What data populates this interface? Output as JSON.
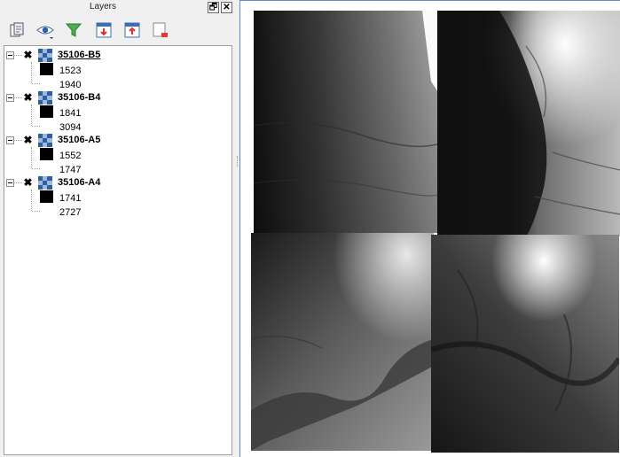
{
  "panel": {
    "title": "Layers",
    "float_symbol": "🗗",
    "close_symbol": "✕"
  },
  "toolbar": {
    "buttons": [
      "add-layer-icon",
      "visibility-icon",
      "filter-icon",
      "expand-all-icon",
      "collapse-all-icon",
      "remove-layer-icon"
    ]
  },
  "layers": [
    {
      "name": "35106-B5",
      "checked": true,
      "min": "1523",
      "max": "1940"
    },
    {
      "name": "35106-B4",
      "checked": true,
      "min": "1841",
      "max": "3094"
    },
    {
      "name": "35106-A5",
      "checked": true,
      "min": "1552",
      "max": "1747"
    },
    {
      "name": "35106-A4",
      "checked": true,
      "min": "1741",
      "max": "2727"
    }
  ],
  "check_symbol": "✖"
}
